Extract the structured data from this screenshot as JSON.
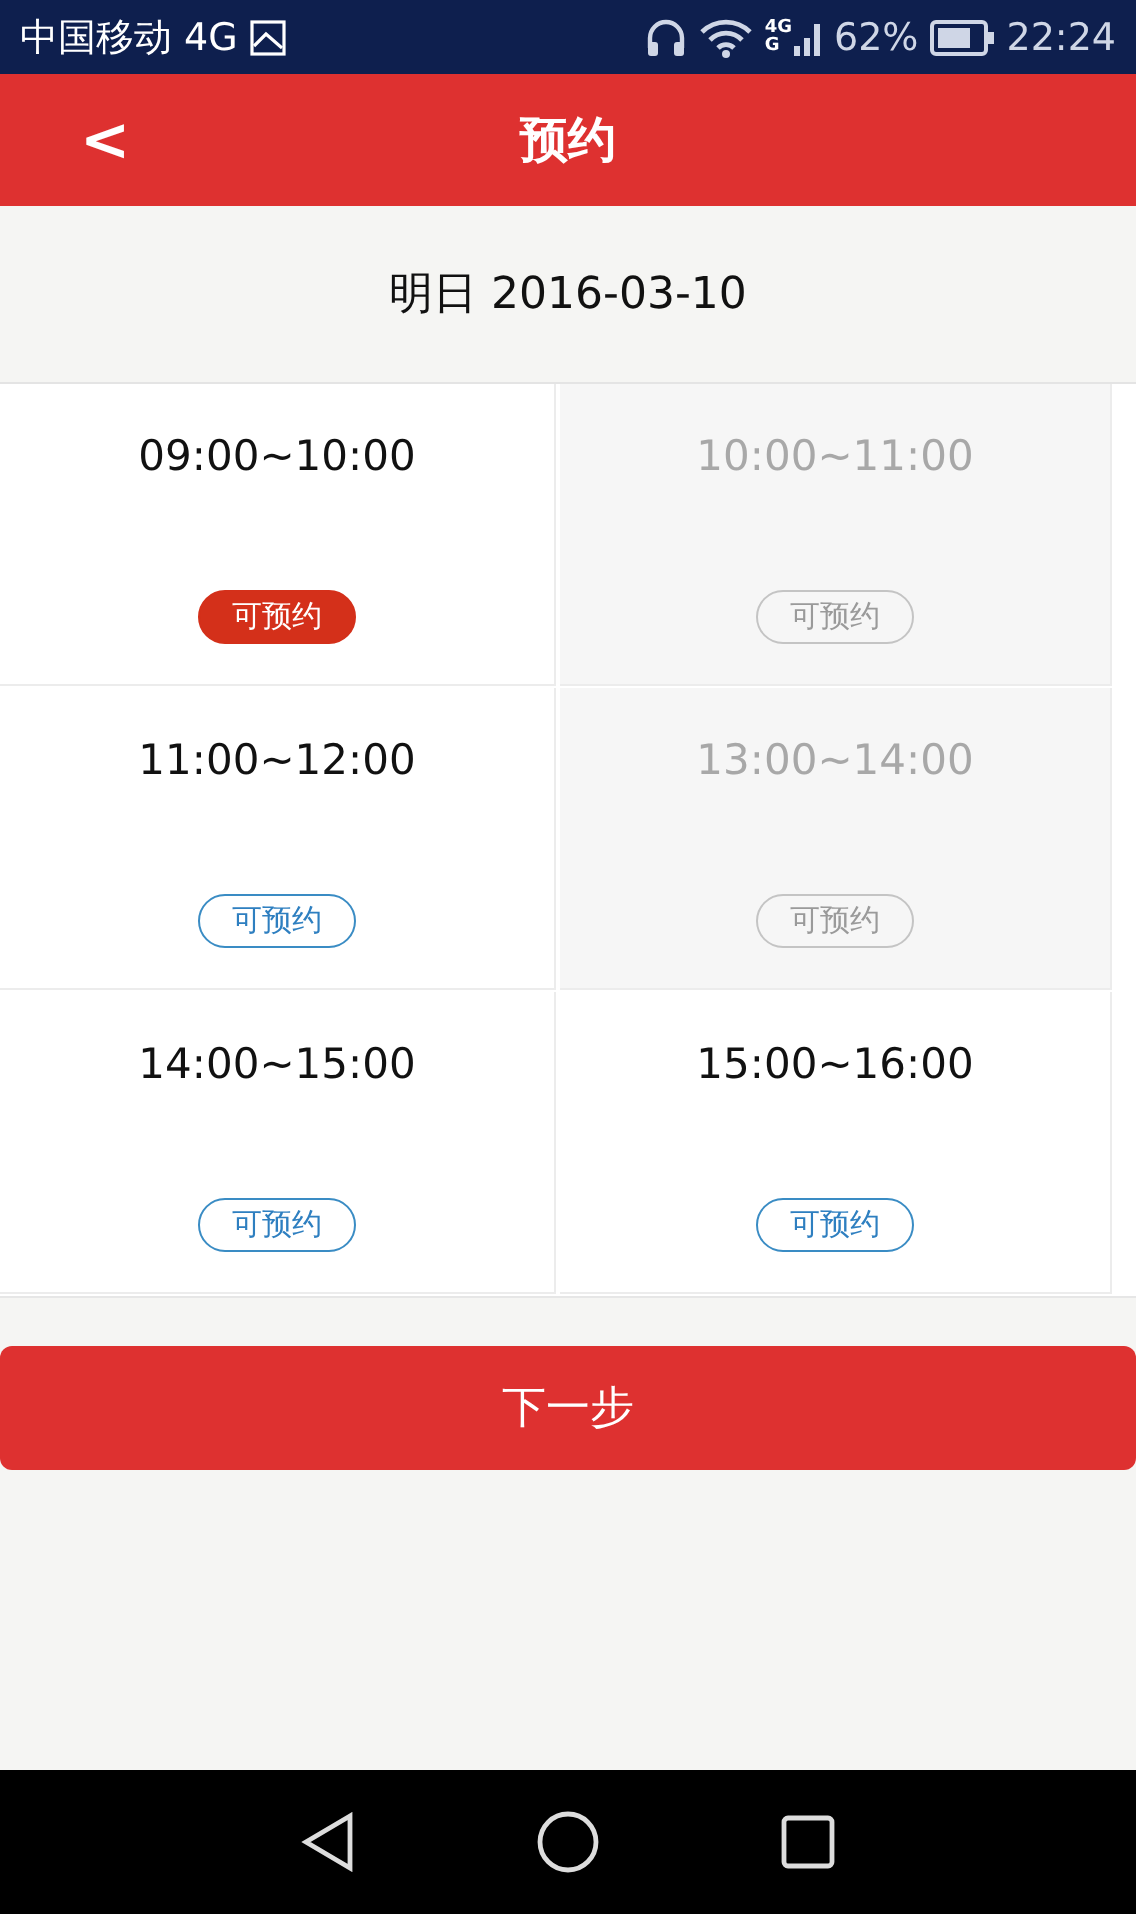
{
  "status_bar": {
    "carrier": "中国移动 4G",
    "network_labels": [
      "4G",
      "G"
    ],
    "battery": "62%",
    "time": "22:24"
  },
  "header": {
    "back": "<",
    "title": "预约"
  },
  "date": "明日 2016-03-10",
  "slots": [
    {
      "time": "09:00~10:00",
      "tag": "可预约",
      "selected": true,
      "disabled": false
    },
    {
      "time": "10:00~11:00",
      "tag": "可预约",
      "selected": false,
      "disabled": true
    },
    {
      "time": "11:00~12:00",
      "tag": "可预约",
      "selected": false,
      "disabled": false
    },
    {
      "time": "13:00~14:00",
      "tag": "可预约",
      "selected": false,
      "disabled": true
    },
    {
      "time": "14:00~15:00",
      "tag": "可预约",
      "selected": false,
      "disabled": false
    },
    {
      "time": "15:00~16:00",
      "tag": "可预约",
      "selected": false,
      "disabled": false
    }
  ],
  "next_button": "下一步"
}
